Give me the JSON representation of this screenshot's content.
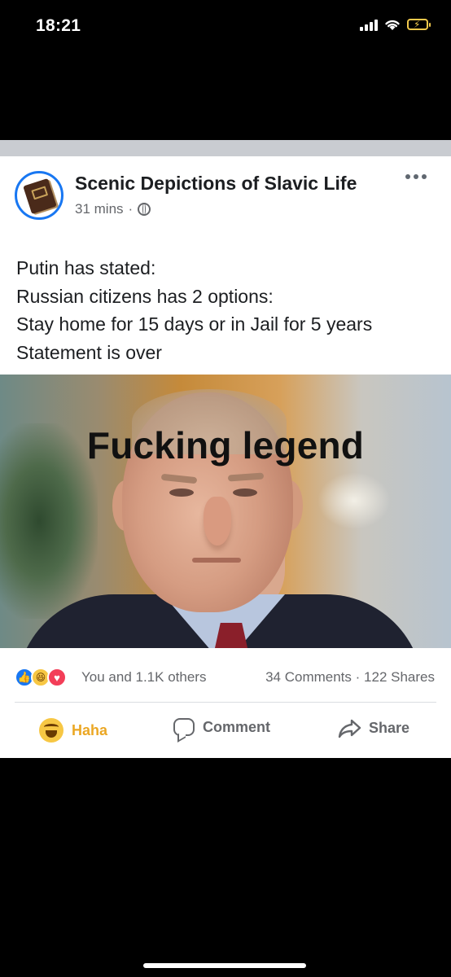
{
  "status_bar": {
    "time": "18:21",
    "icons": [
      "cellular-signal-icon",
      "wifi-icon",
      "battery-charging-icon"
    ]
  },
  "post": {
    "page_name": "Scenic Depictions of Slavic Life",
    "time_ago": "31 mins",
    "separator": "·",
    "privacy_icon": "globe-icon",
    "text_lines": [
      "Putin has stated:",
      "Russian citizens has 2 options:",
      "Stay home for 15 days or in Jail for 5 years",
      "Statement is over"
    ],
    "image_caption": "Fucking legend"
  },
  "reactions": {
    "icons": [
      "like-reaction-icon",
      "haha-reaction-icon",
      "love-reaction-icon"
    ],
    "reactors_text": "You and 1.1K others",
    "comments": "34 Comments",
    "separator": "·",
    "shares": "122 Shares"
  },
  "actions": {
    "haha": "Haha",
    "comment": "Comment",
    "share": "Share"
  },
  "colors": {
    "accent": "#1877f2",
    "haha": "#eba724",
    "muted_text": "#65676b",
    "text": "#1c1e21"
  }
}
